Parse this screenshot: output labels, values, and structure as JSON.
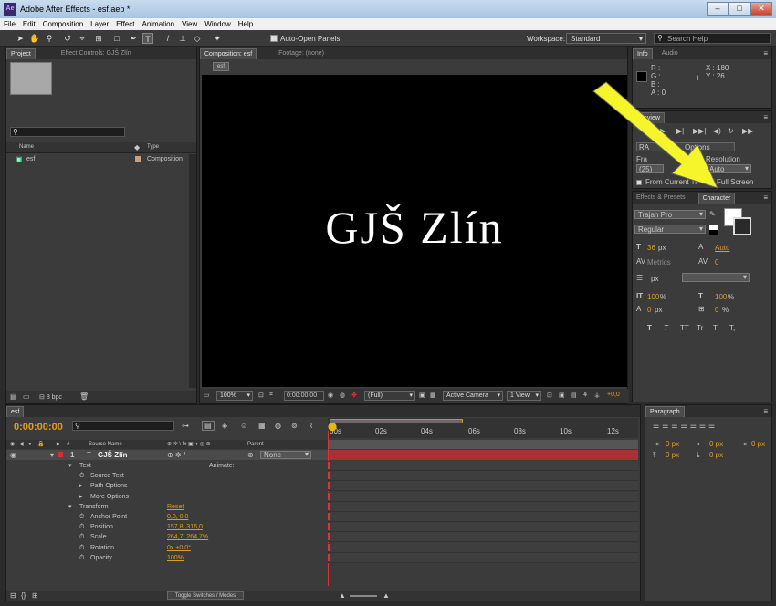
{
  "titlebar": {
    "title": "Adobe After Effects - esf.aep *",
    "min": "–",
    "max": "□",
    "close": "✕"
  },
  "menu": [
    "File",
    "Edit",
    "Composition",
    "Layer",
    "Effect",
    "Animation",
    "View",
    "Window",
    "Help"
  ],
  "toolbar": {
    "auto_open": "Auto-Open Panels",
    "workspace_label": "Workspace:",
    "workspace_value": "Standard",
    "search_placeholder": "Search Help"
  },
  "project": {
    "tabs": [
      "Project",
      "Effect Controls: GJŠ Zlín"
    ],
    "col_name": "Name",
    "col_type": "Type",
    "item_name": "esf",
    "item_type": "Composition",
    "bpc": "8 bpc"
  },
  "comp": {
    "tabs": [
      "Composition: esf",
      "Footage: (none)"
    ],
    "subtab": "esf",
    "text": "GJŠ Zlín",
    "zoom": "100%",
    "time": "0:00:00:00",
    "quality": "(Full)",
    "camera": "Active Camera",
    "views": "1 View",
    "offset": "+0,0"
  },
  "info": {
    "tabs": [
      "Info",
      "Audio"
    ],
    "r": "R :",
    "g": "G :",
    "b": "B :",
    "a": "A : 0",
    "x": "X : 180",
    "y": "Y : 26"
  },
  "preview": {
    "tab": "Preview",
    "ram": "RA",
    "options": "Options",
    "frame_label": "Fra",
    "frame_val": "(25)",
    "res_label": "Resolution",
    "res_val": "Auto",
    "from_current": "From Current Ti",
    "full_screen": "Full Screen"
  },
  "character": {
    "tabs": [
      "Effects & Presets",
      "Character"
    ],
    "font": "Trajan Pro",
    "style": "Regular",
    "size": "36",
    "size_unit": "px",
    "leading": "Auto",
    "kerning": "Metrics",
    "tracking": "0",
    "line_unit": "px",
    "vscale": "100",
    "vscale_unit": "%",
    "hscale": "100",
    "hscale_unit": "%",
    "baseline": "0",
    "baseline_unit": "px",
    "tsume": "0",
    "tsume_unit": "%",
    "styles": [
      "T",
      "T",
      "TT",
      "Tr",
      "T'",
      "T,"
    ]
  },
  "timeline": {
    "tab": "esf",
    "time": "0:00:00:00",
    "ruler": [
      "00s",
      "02s",
      "04s",
      "06s",
      "08s",
      "10s",
      "12s"
    ],
    "col_source": "Source Name",
    "col_parent": "Parent",
    "layer_num": "1",
    "layer_name": "GJŠ Zlín",
    "parent_val": "None",
    "toggle": "Toggle Switches / Modes",
    "rows": [
      {
        "label": "Text",
        "value": "",
        "value2": "Animate:"
      },
      {
        "label": "Source Text",
        "value": "",
        "value2": ""
      },
      {
        "label": "Path Options",
        "value": "",
        "value2": ""
      },
      {
        "label": "More Options",
        "value": "",
        "value2": ""
      },
      {
        "label": "Transform",
        "value": "Reset",
        "value2": ""
      },
      {
        "label": "Anchor Point",
        "value": "0,0, 0,0",
        "value2": ""
      },
      {
        "label": "Position",
        "value": "157,8, 316,0",
        "value2": ""
      },
      {
        "label": "Scale",
        "value": "264,7, 264,7%",
        "value2": ""
      },
      {
        "label": "Rotation",
        "value": "0x +0,0°",
        "value2": ""
      },
      {
        "label": "Opacity",
        "value": "100%",
        "value2": ""
      }
    ]
  },
  "paragraph": {
    "tab": "Paragraph",
    "v1": "0 px",
    "v2": "0 px",
    "v3": "0 px",
    "v4": "0 px",
    "v5": "0 px"
  }
}
